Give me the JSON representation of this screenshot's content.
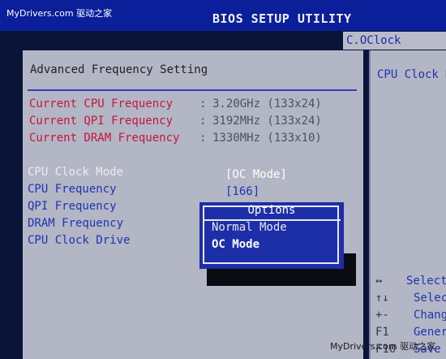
{
  "watermark": {
    "top": "MyDrivers.com 驱动之家",
    "bottom": "MyDrivers.com 驱动之家"
  },
  "header": {
    "title": "BIOS SETUP UTILITY",
    "tab": "C.OClock"
  },
  "main": {
    "heading": "Advanced Frequency Setting",
    "info": [
      {
        "label": "Current CPU  Frequency",
        "sep": ":",
        "value": "3.20GHz (133x24)"
      },
      {
        "label": "Current QPI  Frequency",
        "sep": ":",
        "value": "3192MHz (133x24)"
      },
      {
        "label": "Current DRAM Frequency",
        "sep": ":",
        "value": "1330MHz (133x10)"
      }
    ],
    "settings": [
      {
        "label": "CPU Clock Mode",
        "value": "[OC Mode]"
      },
      {
        "label": " CPU Frequency",
        "value": "[166]"
      },
      {
        "label": "QPI  Frequency",
        "value": ""
      },
      {
        "label": "DRAM Frequency",
        "value": ""
      },
      {
        "label": "CPU  Clock Drive",
        "value": ""
      }
    ]
  },
  "popup": {
    "title": "Options",
    "options": [
      "Normal Mode",
      "OC Mode"
    ],
    "selected": "OC Mode"
  },
  "side": {
    "description": "CPU Clock M",
    "help": [
      {
        "key": "↔",
        "text": "Select"
      },
      {
        "key": "↑↓",
        "text": "Selec"
      },
      {
        "key": "+-",
        "text": "Chang"
      },
      {
        "key": "F1",
        "text": "Gener"
      },
      {
        "key": "F10",
        "text": "Save"
      }
    ]
  }
}
